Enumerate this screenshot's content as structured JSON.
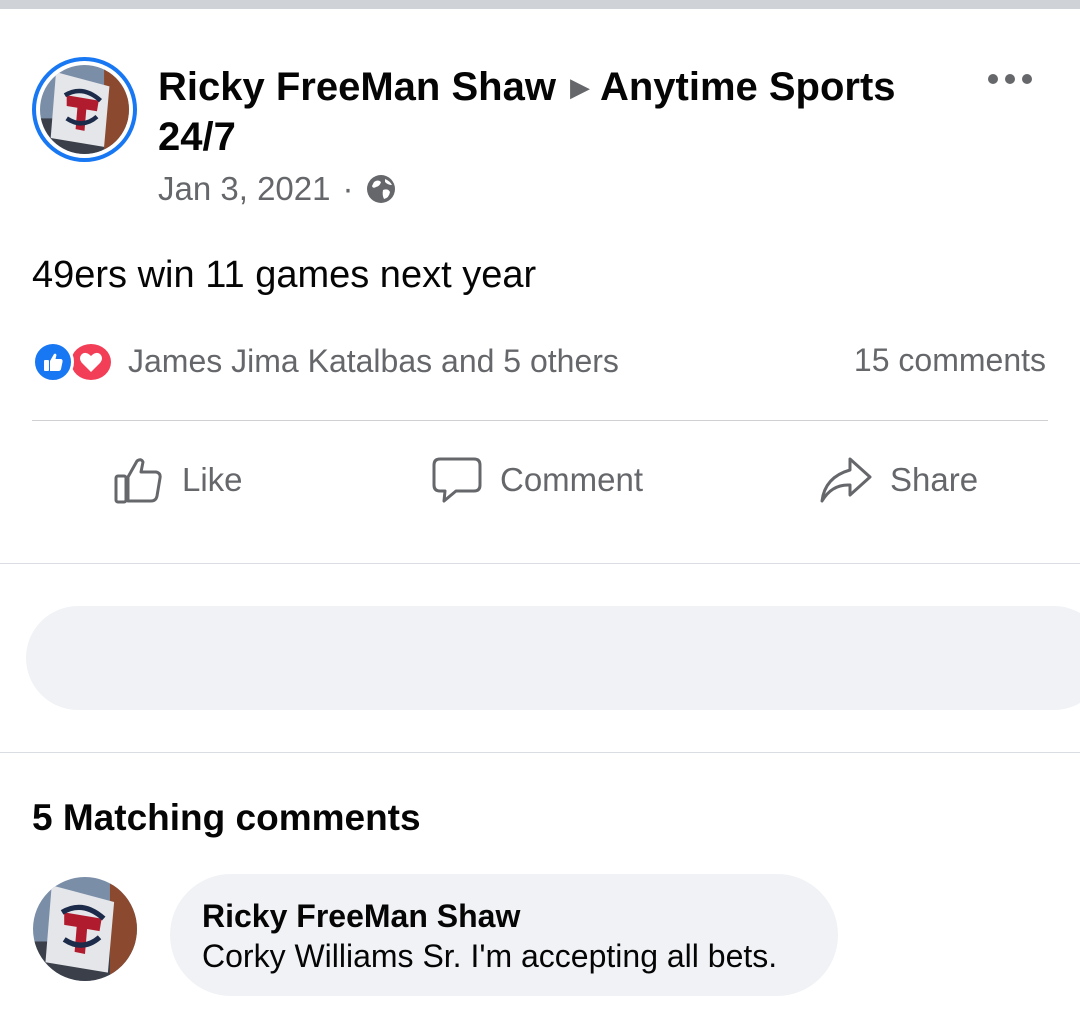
{
  "post": {
    "author": "Ricky FreeMan Shaw",
    "separator": "▶",
    "group": "Anytime Sports 24/7",
    "date": "Jan 3, 2021",
    "dot": "·",
    "privacy_icon": "globe-icon",
    "text": "49ers win 11 games next year",
    "reactions": {
      "icons": [
        "like-reaction-icon",
        "love-reaction-icon"
      ],
      "summary": "James Jima Katalbas and 5 others"
    },
    "comments_count": "15 comments"
  },
  "actions": {
    "like": "Like",
    "comment": "Comment",
    "share": "Share"
  },
  "comments_section": {
    "heading": "5 Matching comments",
    "items": [
      {
        "author": "Ricky FreeMan Shaw",
        "text": "Corky Williams Sr. I'm accepting all bets."
      }
    ]
  },
  "colors": {
    "accent": "#1877f2",
    "love": "#f33e58",
    "secondary_text": "#65676b",
    "input_bg": "#f0f2f5"
  }
}
